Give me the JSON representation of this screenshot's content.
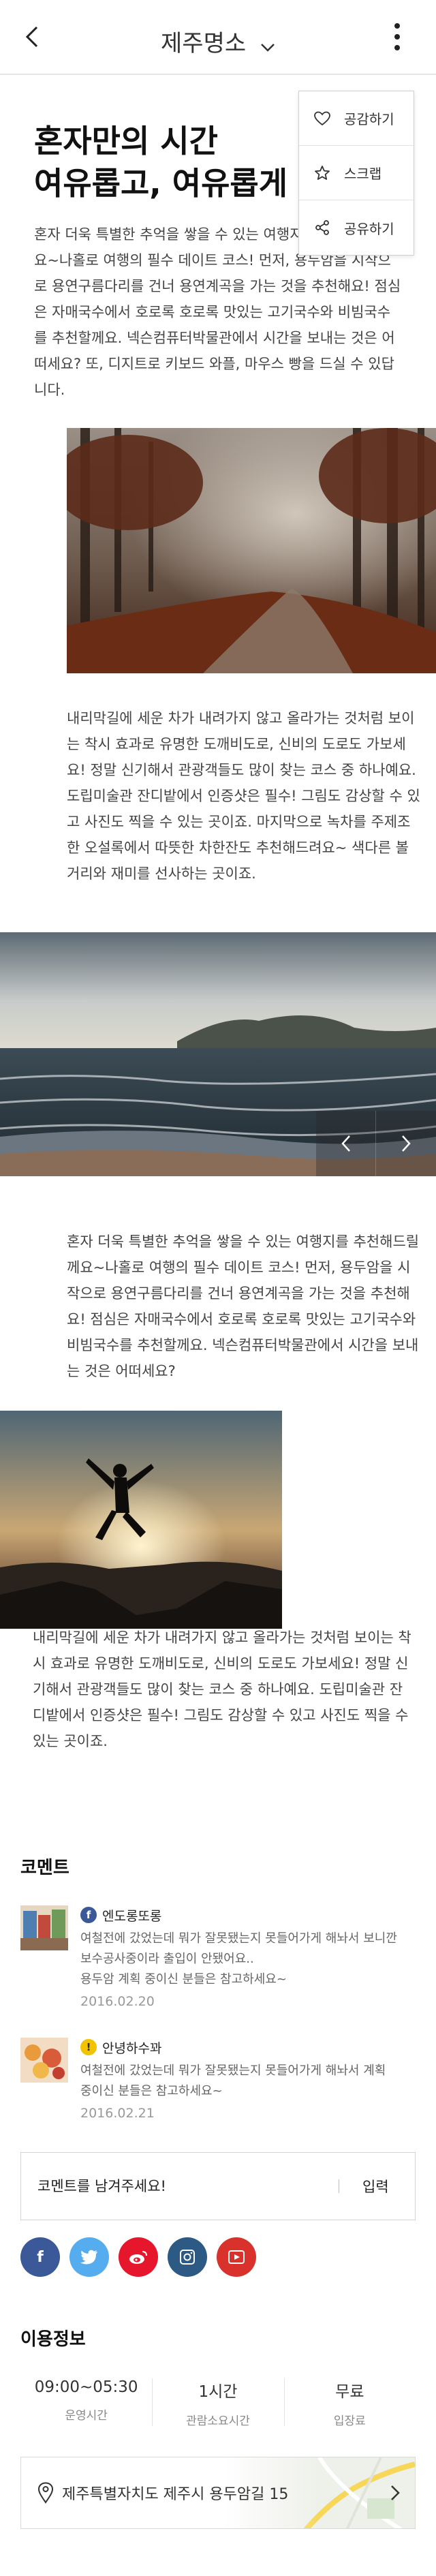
{
  "header": {
    "title": "제주명소",
    "back_icon": "arrow-left-icon",
    "more_icon": "vertical-dots-icon"
  },
  "popup_menu": {
    "items": [
      {
        "label": "공감하기",
        "icon": "heart-icon"
      },
      {
        "label": "스크랩",
        "icon": "star-icon"
      },
      {
        "label": "공유하기",
        "icon": "share-icon"
      }
    ]
  },
  "article": {
    "title_line1": "혼자만의 시간",
    "title_line2": "여유롭고, 여유롭게 담겨",
    "paragraph1": "혼자 더욱 특별한 추억을 쌓을 수 있는 여행지를 추천해드릴께요~나홀로 여행의 필수 데이트 코스! 먼저, 용두암을 시작으로 용연구름다리를 건너 용연계곡을 가는 것을 추천해요! 점심은 자매국수에서 호로록 호로록 맛있는 고기국수와 비빔국수를 추천할께요. 넥슨컴퓨터박물관에서 시간을 보내는 것은 어떠세요? 또, 디지트로 키보드 와플, 마우스 빵을 드실 수 있답니다.",
    "paragraph2": "내리막길에 세운 차가 내려가지 않고 올라가는 것처럼 보이는 착시 효과로 유명한 도깨비도로, 신비의 도로도 가보세요! 정말 신기해서 관광객들도 많이 찾는 코스 중 하나예요. 도립미술관 잔디밭에서 인증샷은 필수! 그림도 감상할 수 있고 사진도 찍을 수 있는 곳이죠. 마지막으로 녹차를 주제조 한 오설록에서 따뜻한 차한잔도 추천해드려요~ 색다른 볼거리와 재미를 선사하는 곳이죠.",
    "paragraph3": "혼자 더욱 특별한 추억을 쌓을 수 있는 여행지를 추천해드릴께요~나홀로 여행의 필수 데이트 코스! 먼저, 용두암을 시작으로 용연구름다리를 건너 용연계곡을 가는 것을 추천해요! 점심은 자매국수에서 호로록 호로록 맛있는 고기국수와 비빔국수를 추천할께요. 넥슨컴퓨터박물관에서 시간을 보내는 것은 어떠세요?",
    "paragraph4": "내리막길에 세운 차가 내려가지 않고 올라가는 것처럼 보이는 착시 효과로 유명한 도깨비도로, 신비의 도로도 가보세요! 정말 신기해서 관광객들도 많이 찾는 코스 중 하나예요. 도립미술관 잔디밭에서 인증샷은 필수! 그림도 감상할 수 있고 사진도 찍을 수 있는 곳이죠."
  },
  "carousel": {
    "prev_icon": "chevron-left-icon",
    "next_icon": "chevron-right-icon"
  },
  "comments": {
    "title": "코멘트",
    "items": [
      {
        "author": "엔도롱또롱",
        "sns": "facebook",
        "text_line1": "여철전에 갔었는데 뭐가 잘못됐는지 못들어가게 해놔서 보니깐",
        "text_line2": "보수공사중이라 출입이 안됐어요..",
        "text_line3": "용두암 계획 중이신 분들은 참고하세요~",
        "date": "2016.02.20"
      },
      {
        "author": "안녕하수꽈",
        "sns": "kakao",
        "text_line1": "여철전에 갔었는데 뭐가 잘못됐는지 못들어가게 해놔서 계획",
        "text_line2": "중이신 분들은 참고하세요~",
        "date": "2016.02.21"
      }
    ],
    "input_placeholder": "코멘트를 남겨주세요!",
    "submit_label": "입력"
  },
  "share": {
    "buttons": [
      {
        "name": "facebook",
        "color": "#3b5998"
      },
      {
        "name": "twitter",
        "color": "#55acee"
      },
      {
        "name": "weibo",
        "color": "#e6162d"
      },
      {
        "name": "instagram",
        "color": "#2c5a85"
      },
      {
        "name": "youtube",
        "color": "#d9322c"
      }
    ]
  },
  "info": {
    "title": "이용정보",
    "hours_value": "09:00~05:30",
    "hours_label": "운영시간",
    "duration_value": "1시간",
    "duration_label": "관람소요시간",
    "fee_value": "무료",
    "fee_label": "입장료",
    "address": "제주특별자치도 제주시 용두암길 15"
  }
}
